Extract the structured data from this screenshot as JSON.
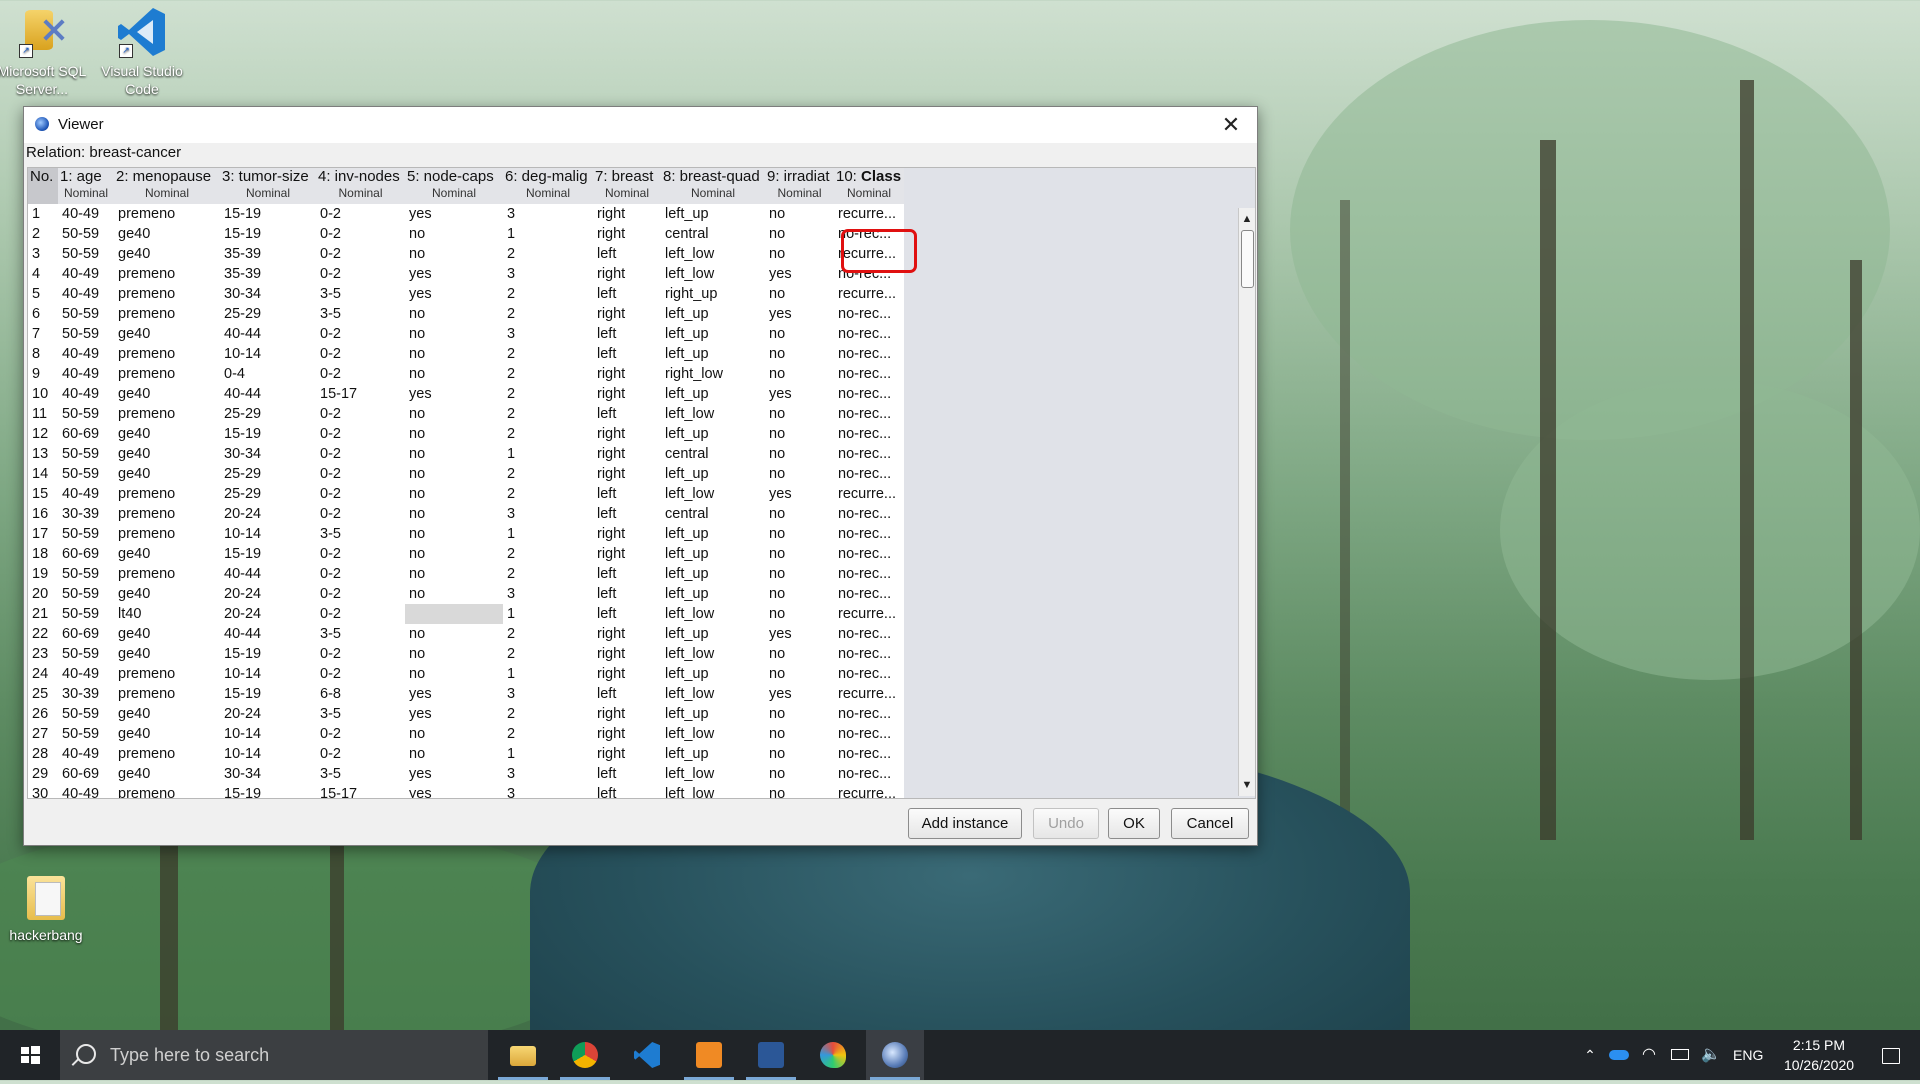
{
  "desktop": {
    "icons": [
      {
        "label": "Microsoft SQL Server...",
        "icon": "sql-server-icon"
      },
      {
        "label": "Visual Studio Code",
        "icon": "vscode-icon"
      },
      {
        "label": "hackerbang",
        "icon": "folder-icon"
      }
    ]
  },
  "window": {
    "title": "Viewer",
    "relation": "Relation: breast-cancer",
    "close_glyph": "✕"
  },
  "table": {
    "no_header": "No.",
    "columns": [
      {
        "name": "1: age",
        "type": "Nominal"
      },
      {
        "name": "2: menopause",
        "type": "Nominal"
      },
      {
        "name": "3: tumor-size",
        "type": "Nominal"
      },
      {
        "name": "4: inv-nodes",
        "type": "Nominal"
      },
      {
        "name": "5: node-caps",
        "type": "Nominal"
      },
      {
        "name": "6: deg-malig",
        "type": "Nominal"
      },
      {
        "name": "7: breast",
        "type": "Nominal"
      },
      {
        "name": "8: breast-quad",
        "type": "Nominal"
      },
      {
        "name": "9: irradiat",
        "type": "Nominal"
      },
      {
        "name_prefix": "10: ",
        "name_bold": "Class",
        "type": "Nominal"
      }
    ],
    "rows": [
      [
        "1",
        "40-49",
        "premeno",
        "15-19",
        "0-2",
        "yes",
        "3",
        "right",
        "left_up",
        "no",
        "recurre..."
      ],
      [
        "2",
        "50-59",
        "ge40",
        "15-19",
        "0-2",
        "no",
        "1",
        "right",
        "central",
        "no",
        "no-rec..."
      ],
      [
        "3",
        "50-59",
        "ge40",
        "35-39",
        "0-2",
        "no",
        "2",
        "left",
        "left_low",
        "no",
        "recurre..."
      ],
      [
        "4",
        "40-49",
        "premeno",
        "35-39",
        "0-2",
        "yes",
        "3",
        "right",
        "left_low",
        "yes",
        "no-rec..."
      ],
      [
        "5",
        "40-49",
        "premeno",
        "30-34",
        "3-5",
        "yes",
        "2",
        "left",
        "right_up",
        "no",
        "recurre..."
      ],
      [
        "6",
        "50-59",
        "premeno",
        "25-29",
        "3-5",
        "no",
        "2",
        "right",
        "left_up",
        "yes",
        "no-rec..."
      ],
      [
        "7",
        "50-59",
        "ge40",
        "40-44",
        "0-2",
        "no",
        "3",
        "left",
        "left_up",
        "no",
        "no-rec..."
      ],
      [
        "8",
        "40-49",
        "premeno",
        "10-14",
        "0-2",
        "no",
        "2",
        "left",
        "left_up",
        "no",
        "no-rec..."
      ],
      [
        "9",
        "40-49",
        "premeno",
        "0-4",
        "0-2",
        "no",
        "2",
        "right",
        "right_low",
        "no",
        "no-rec..."
      ],
      [
        "10",
        "40-49",
        "ge40",
        "40-44",
        "15-17",
        "yes",
        "2",
        "right",
        "left_up",
        "yes",
        "no-rec..."
      ],
      [
        "11",
        "50-59",
        "premeno",
        "25-29",
        "0-2",
        "no",
        "2",
        "left",
        "left_low",
        "no",
        "no-rec..."
      ],
      [
        "12",
        "60-69",
        "ge40",
        "15-19",
        "0-2",
        "no",
        "2",
        "right",
        "left_up",
        "no",
        "no-rec..."
      ],
      [
        "13",
        "50-59",
        "ge40",
        "30-34",
        "0-2",
        "no",
        "1",
        "right",
        "central",
        "no",
        "no-rec..."
      ],
      [
        "14",
        "50-59",
        "ge40",
        "25-29",
        "0-2",
        "no",
        "2",
        "right",
        "left_up",
        "no",
        "no-rec..."
      ],
      [
        "15",
        "40-49",
        "premeno",
        "25-29",
        "0-2",
        "no",
        "2",
        "left",
        "left_low",
        "yes",
        "recurre..."
      ],
      [
        "16",
        "30-39",
        "premeno",
        "20-24",
        "0-2",
        "no",
        "3",
        "left",
        "central",
        "no",
        "no-rec..."
      ],
      [
        "17",
        "50-59",
        "premeno",
        "10-14",
        "3-5",
        "no",
        "1",
        "right",
        "left_up",
        "no",
        "no-rec..."
      ],
      [
        "18",
        "60-69",
        "ge40",
        "15-19",
        "0-2",
        "no",
        "2",
        "right",
        "left_up",
        "no",
        "no-rec..."
      ],
      [
        "19",
        "50-59",
        "premeno",
        "40-44",
        "0-2",
        "no",
        "2",
        "left",
        "left_up",
        "no",
        "no-rec..."
      ],
      [
        "20",
        "50-59",
        "ge40",
        "20-24",
        "0-2",
        "no",
        "3",
        "left",
        "left_up",
        "no",
        "no-rec..."
      ],
      [
        "21",
        "50-59",
        "lt40",
        "20-24",
        "0-2",
        "",
        "1",
        "left",
        "left_low",
        "no",
        "recurre..."
      ],
      [
        "22",
        "60-69",
        "ge40",
        "40-44",
        "3-5",
        "no",
        "2",
        "right",
        "left_up",
        "yes",
        "no-rec..."
      ],
      [
        "23",
        "50-59",
        "ge40",
        "15-19",
        "0-2",
        "no",
        "2",
        "right",
        "left_low",
        "no",
        "no-rec..."
      ],
      [
        "24",
        "40-49",
        "premeno",
        "10-14",
        "0-2",
        "no",
        "1",
        "right",
        "left_up",
        "no",
        "no-rec..."
      ],
      [
        "25",
        "30-39",
        "premeno",
        "15-19",
        "6-8",
        "yes",
        "3",
        "left",
        "left_low",
        "yes",
        "recurre..."
      ],
      [
        "26",
        "50-59",
        "ge40",
        "20-24",
        "3-5",
        "yes",
        "2",
        "right",
        "left_up",
        "no",
        "no-rec..."
      ],
      [
        "27",
        "50-59",
        "ge40",
        "10-14",
        "0-2",
        "no",
        "2",
        "right",
        "left_low",
        "no",
        "no-rec..."
      ],
      [
        "28",
        "40-49",
        "premeno",
        "10-14",
        "0-2",
        "no",
        "1",
        "right",
        "left_up",
        "no",
        "no-rec..."
      ],
      [
        "29",
        "60-69",
        "ge40",
        "30-34",
        "3-5",
        "yes",
        "3",
        "left",
        "left_low",
        "no",
        "no-rec..."
      ],
      [
        "30",
        "40-49",
        "premeno",
        "15-19",
        "15-17",
        "yes",
        "3",
        "left",
        "left_low",
        "no",
        "recurre..."
      ]
    ],
    "missing_value_note": "row 21 node-caps is empty (missing)"
  },
  "buttons": {
    "add_instance": "Add instance",
    "undo": "Undo",
    "ok": "OK",
    "cancel": "Cancel"
  },
  "taskbar": {
    "search_placeholder": "Type here to search",
    "apps": [
      "file-explorer-icon",
      "chrome-icon",
      "vscode-icon",
      "foxit-pdf-icon",
      "word-icon",
      "paint-icon",
      "weka-icon"
    ],
    "language": "ENG",
    "time": "2:15 PM",
    "date": "10/26/2020"
  },
  "colors": {
    "highlight_border": "#e01010",
    "taskbar": "#202428"
  }
}
